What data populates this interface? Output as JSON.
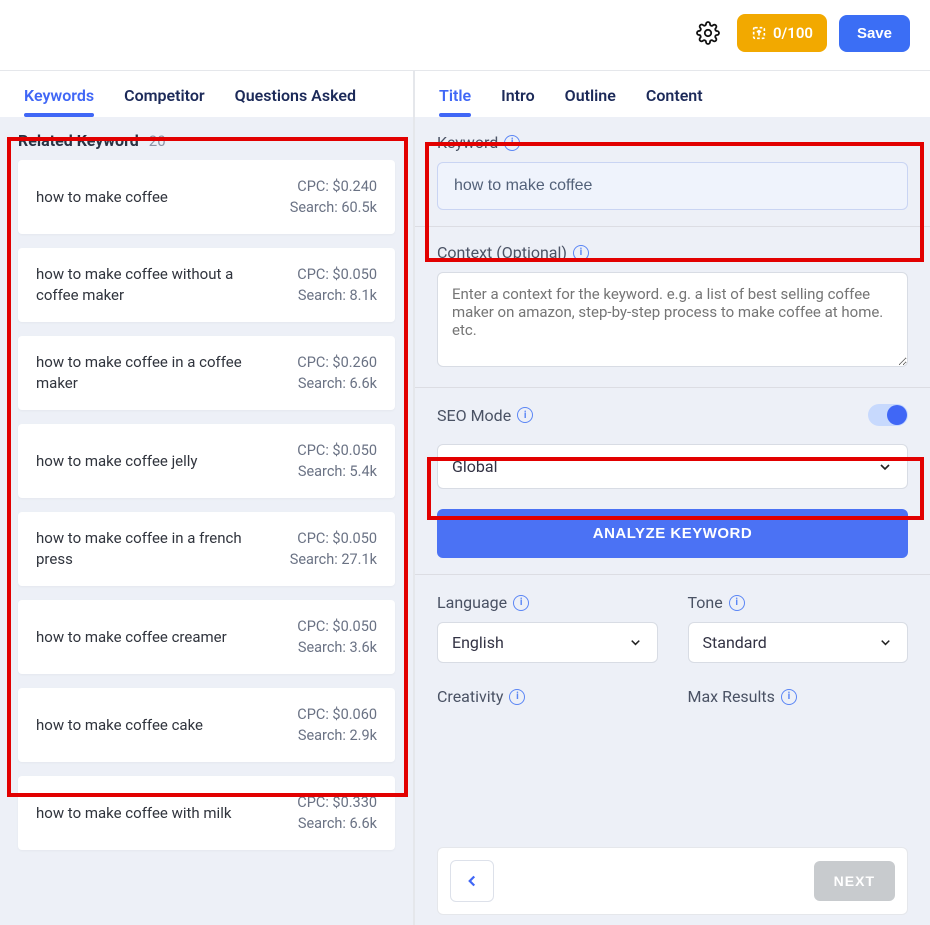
{
  "topbar": {
    "usage": "0/100",
    "save_label": "Save"
  },
  "left_tabs": [
    {
      "label": "Keywords",
      "active": true
    },
    {
      "label": "Competitor",
      "active": false
    },
    {
      "label": "Questions Asked",
      "active": false
    }
  ],
  "right_tabs": [
    {
      "label": "Title",
      "active": true
    },
    {
      "label": "Intro",
      "active": false
    },
    {
      "label": "Outline",
      "active": false
    },
    {
      "label": "Content",
      "active": false
    }
  ],
  "related": {
    "title": "Related Keyword",
    "count": "20",
    "items": [
      {
        "text": "how to make coffee",
        "cpc": "CPC: $0.240",
        "search": "Search: 60.5k"
      },
      {
        "text": "how to make coffee without a coffee maker",
        "cpc": "CPC: $0.050",
        "search": "Search: 8.1k"
      },
      {
        "text": "how to make coffee in a coffee maker",
        "cpc": "CPC: $0.260",
        "search": "Search: 6.6k"
      },
      {
        "text": "how to make coffee jelly",
        "cpc": "CPC: $0.050",
        "search": "Search: 5.4k"
      },
      {
        "text": "how to make coffee in a french press",
        "cpc": "CPC: $0.050",
        "search": "Search: 27.1k"
      },
      {
        "text": "how to make coffee creamer",
        "cpc": "CPC: $0.050",
        "search": "Search: 3.6k"
      },
      {
        "text": "how to make coffee cake",
        "cpc": "CPC: $0.060",
        "search": "Search: 2.9k"
      },
      {
        "text": "how to make coffee with milk",
        "cpc": "CPC: $0.330",
        "search": "Search: 6.6k"
      }
    ]
  },
  "form": {
    "keyword_label": "Keyword",
    "keyword_value": "how to make coffee",
    "context_label": "Context (Optional)",
    "context_placeholder": "Enter a context for the keyword. e.g. a list of best selling coffee maker on amazon, step-by-step process to make coffee at home. etc.",
    "seo_label": "SEO Mode",
    "region_value": "Global",
    "analyze_label": "ANALYZE KEYWORD",
    "language_label": "Language",
    "language_value": "English",
    "tone_label": "Tone",
    "tone_value": "Standard",
    "creativity_label": "Creativity",
    "maxresults_label": "Max Results",
    "next_label": "NEXT"
  }
}
